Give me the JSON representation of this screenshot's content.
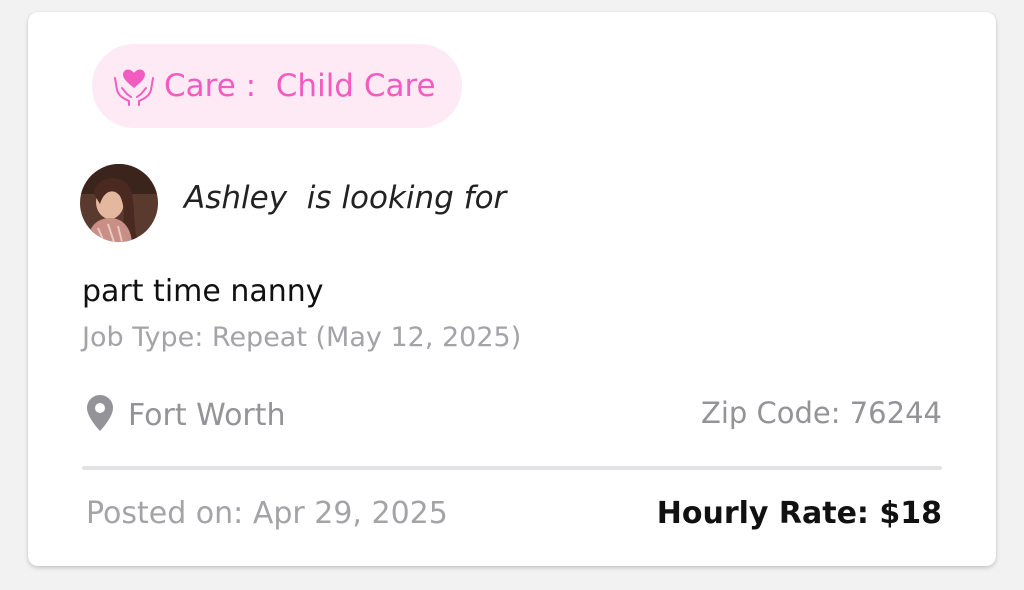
{
  "card": {
    "care_tag": {
      "icon": "heart-hands-icon",
      "label": "Care :  Child Care",
      "color": "#f25cc0",
      "background": "#fdeaf4"
    },
    "poster": {
      "avatar": "avatar",
      "name": "Ashley",
      "suffix": "  is looking for"
    },
    "job_title": "part time nanny",
    "job_type": "Job Type: Repeat (May 12, 2025)",
    "location": {
      "icon": "location-pin-icon",
      "city": "Fort Worth"
    },
    "zip": "Zip Code: 76244",
    "posted_on": "Posted on: Apr 29, 2025",
    "hourly_rate": "Hourly Rate: $18"
  }
}
